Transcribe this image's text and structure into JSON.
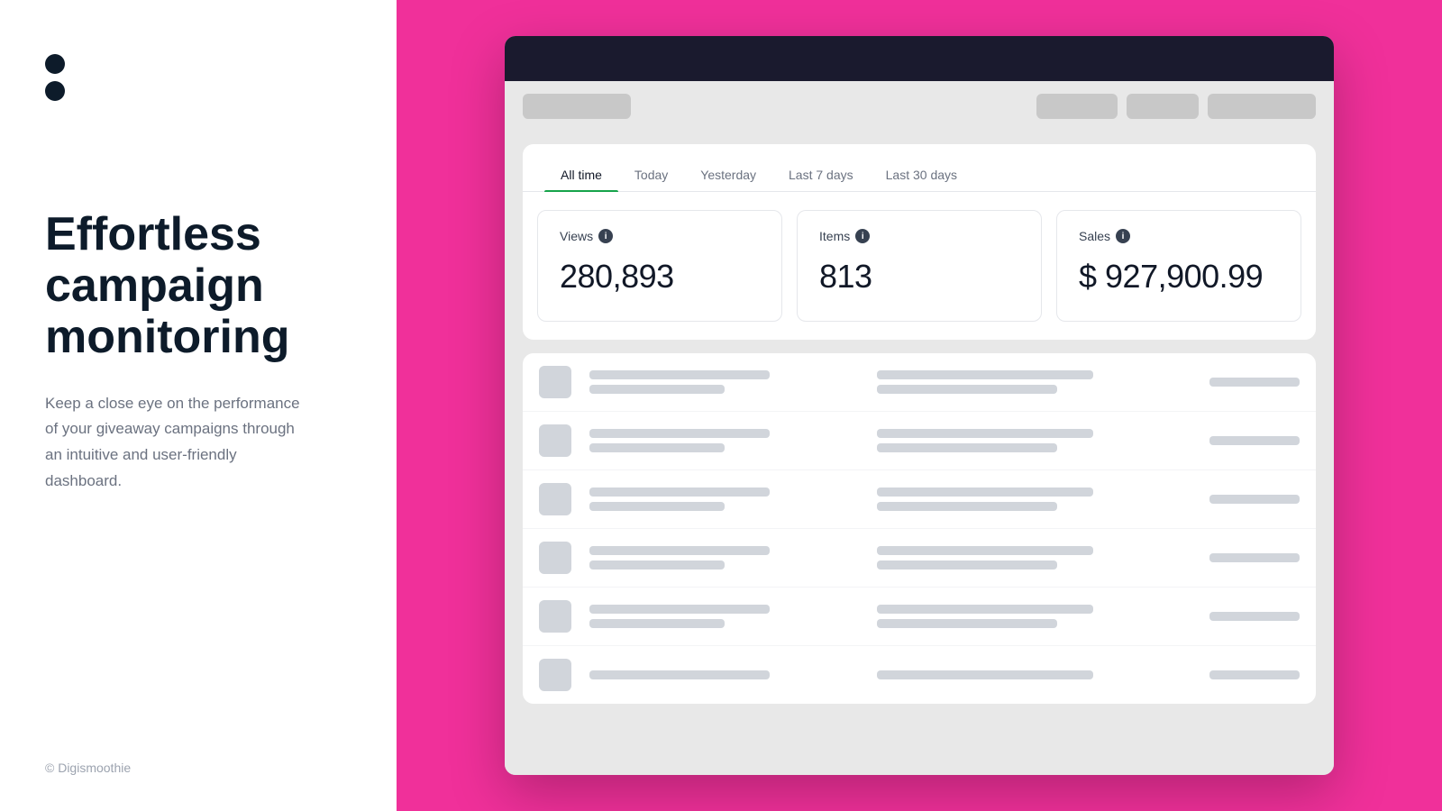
{
  "left": {
    "logo_dot_count": 2,
    "headline": "Effortless campaign monitoring",
    "subtext": "Keep a close eye on the performance of your giveaway campaigns through an intuitive and user-friendly dashboard.",
    "copyright": "© Digismoothie"
  },
  "dashboard": {
    "tabs": [
      {
        "label": "All time",
        "active": true
      },
      {
        "label": "Today",
        "active": false
      },
      {
        "label": "Yesterday",
        "active": false
      },
      {
        "label": "Last 7 days",
        "active": false
      },
      {
        "label": "Last 30 days",
        "active": false
      }
    ],
    "metrics": [
      {
        "label": "Views",
        "value": "280,893"
      },
      {
        "label": "Items",
        "value": "813"
      },
      {
        "label": "Sales",
        "value": "$ 927,900.99"
      }
    ]
  },
  "colors": {
    "pink_bg": "#f0309a",
    "active_tab_underline": "#16a34a",
    "dark_header": "#1a1a2e"
  }
}
